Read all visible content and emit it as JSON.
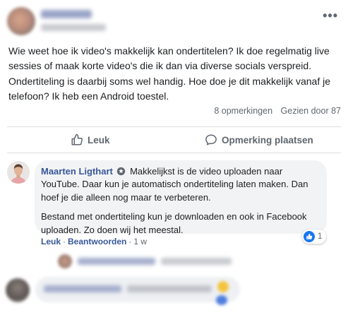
{
  "post": {
    "text": "Wie weet hoe ik video's makkelijk kan ondertitelen? Ik doe regelmatig live sessies of maak korte video's die ik dan via diverse socials verspreid. Ondertiteling is daarbij soms wel handig. Hoe doe je dit makkelijk vanaf je telefoon? Ik heb een Android toestel.",
    "more_icon": "more-horizontal-icon",
    "comments_count": "8 opmerkingen",
    "views": "Gezien door 87"
  },
  "actions": {
    "like_label": "Leuk",
    "like_icon": "thumbs-up-icon",
    "comment_label": "Opmerking plaatsen",
    "comment_icon": "speech-bubble-icon"
  },
  "comment": {
    "author": "Maarten Ligthart",
    "badge_icon": "expert-badge-icon",
    "paragraph1": "Makkelijkst is de video uploaden naar YouTube. Daar kun je automatisch ondertiteling laten maken. Dan hoef je die alleen nog maar te verbeteren.",
    "paragraph2": "Bestand met ondertiteling kun je downloaden en ook in Facebook uploaden. Zo doen wij het meestal.",
    "reaction_count": "1",
    "like_link": "Leuk",
    "reply_link": "Beantwoorden",
    "separator": "·",
    "time": "1 w"
  },
  "colors": {
    "link": "#385898",
    "muted": "#606770",
    "bubble": "#f2f3f5",
    "accent": "#1877f2"
  }
}
